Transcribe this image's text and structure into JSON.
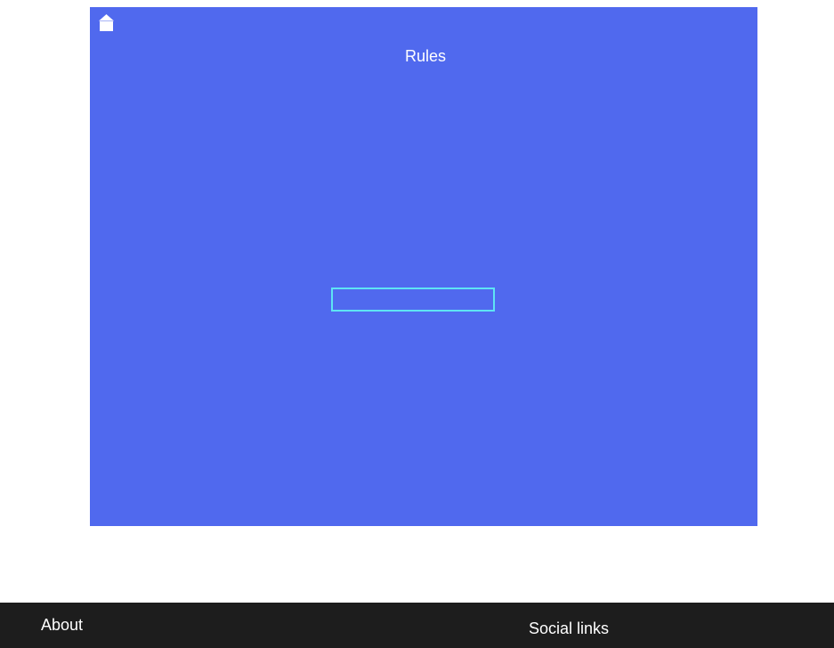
{
  "stage": {
    "title": "Rules",
    "home_icon": "home-icon",
    "input": {
      "value": "",
      "placeholder": ""
    }
  },
  "footer": {
    "about": "About",
    "social": "Social links"
  },
  "colors": {
    "stage_background": "#5069ee",
    "input_border": "#5ee4f4",
    "footer_background": "#1d1d1d",
    "text": "#ffffff"
  }
}
